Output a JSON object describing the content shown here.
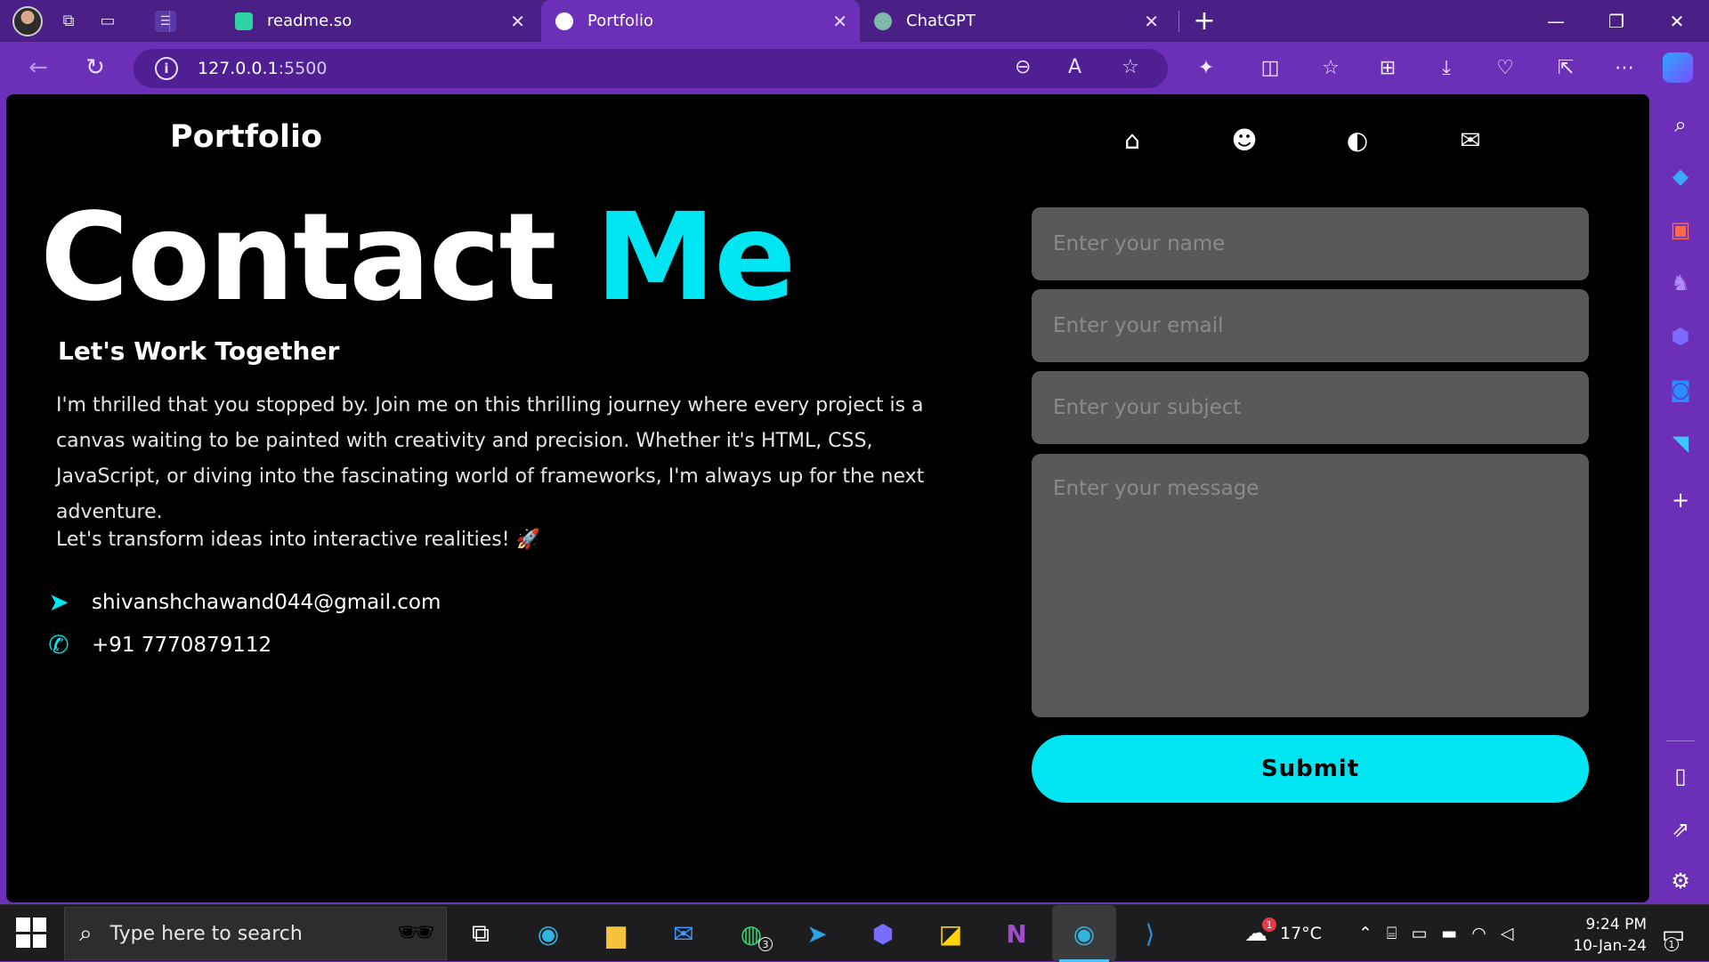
{
  "browser": {
    "tabs": [
      {
        "label": "readme.so",
        "active": false
      },
      {
        "label": "Portfolio",
        "active": true
      },
      {
        "label": "ChatGPT",
        "active": false
      }
    ],
    "new_tab_symbol": "+",
    "url_host": "127.0.0.1",
    "url_port": ":5500"
  },
  "page": {
    "brand": "Portfolio",
    "headline_white": "Contact",
    "headline_accent": "Me",
    "subhead": "Let's Work Together",
    "paragraph": "I'm thrilled that you stopped by. Join me on this thrilling journey where every project is a canvas waiting to be painted with creativity and precision. Whether it's HTML, CSS, JavaScript, or diving into the fascinating world of frameworks, I'm always up for the next adventure.",
    "tagline": "Let's transform ideas into interactive realities! 🚀",
    "email": "shivanshchawand044@gmail.com",
    "phone": "+91 7770879112",
    "accent_color": "#00e5f2"
  },
  "form": {
    "name_placeholder": "Enter your name",
    "email_placeholder": "Enter your email",
    "subject_placeholder": "Enter your subject",
    "message_placeholder": "Enter your message",
    "submit_label": "Submit"
  },
  "taskbar": {
    "search_placeholder": "Type here to search",
    "weather": "17°C",
    "weather_badge": "1",
    "whatsapp_badge": "3",
    "time": "9:24 PM",
    "date": "10-Jan-24",
    "notification_count": "1"
  }
}
